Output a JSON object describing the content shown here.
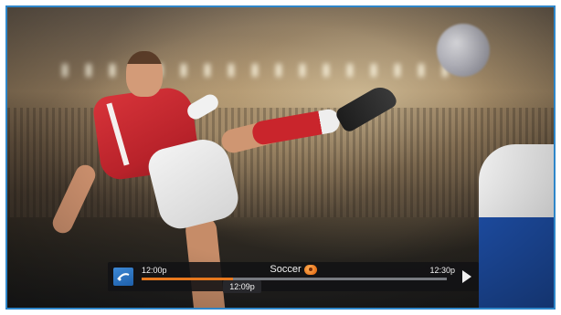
{
  "program": {
    "title": "Soccer",
    "start_time": "12:00p",
    "end_time": "12:30p",
    "current_time": "12:09p",
    "progress_fraction": 0.3,
    "rating_badge_icon": "rating-badge-icon"
  },
  "colors": {
    "frame_border": "#2e86c9",
    "progress_fill": "#e8781e",
    "progress_track": "#777a80",
    "bar_background": "#121214"
  },
  "icons": {
    "logo": "directv-logo-icon",
    "play": "play-icon"
  }
}
